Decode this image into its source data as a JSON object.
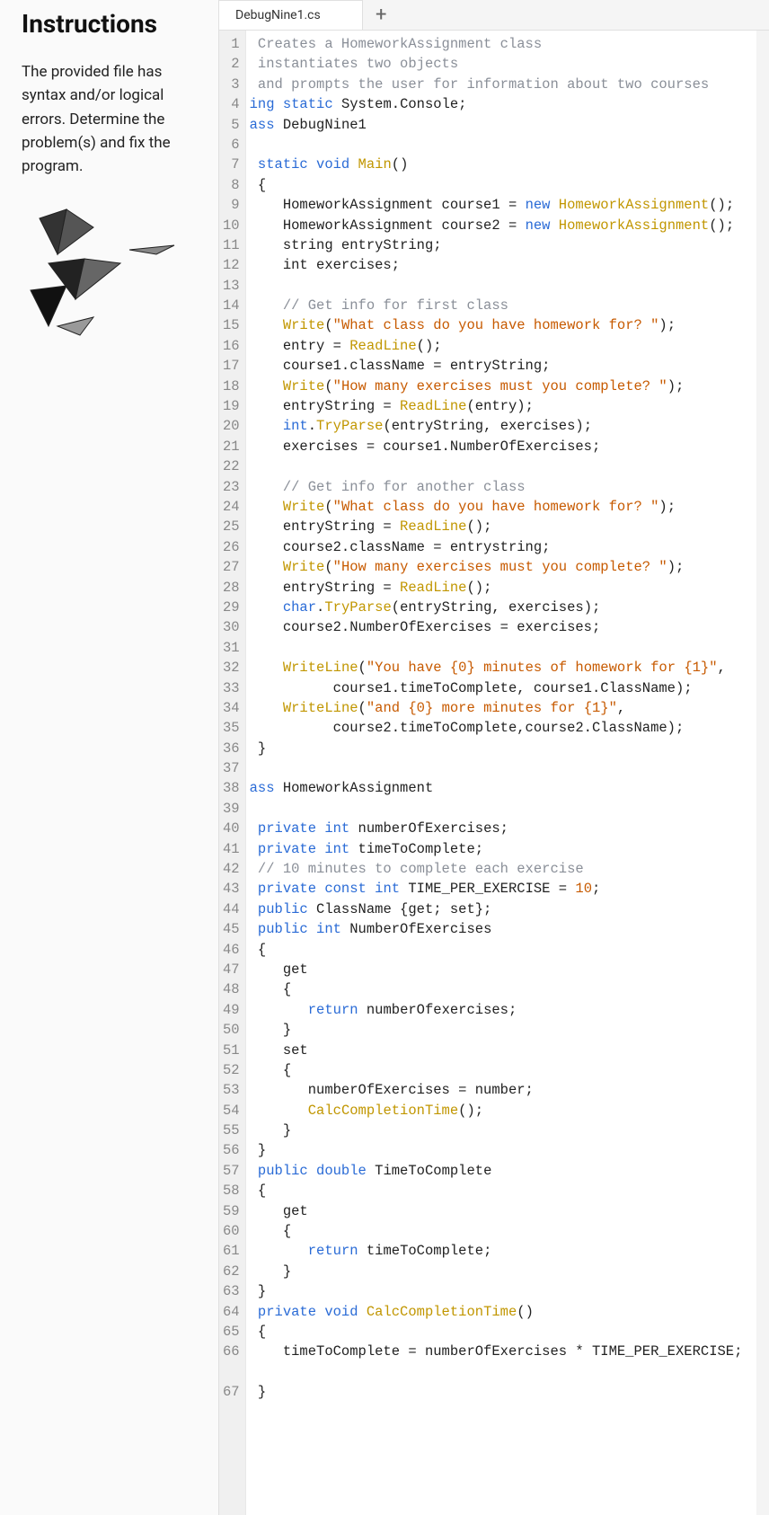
{
  "sidebar": {
    "title": "Instructions",
    "body": "The provided file has syntax and/or logical errors. Determine the problem(s) and fix the program."
  },
  "tabs": {
    "active": "DebugNine1.cs",
    "add_label": "+"
  },
  "code": [
    {
      "n": 1,
      "tokens": [
        {
          "t": " Creates a HomeworkAssignment class",
          "c": "comment"
        }
      ]
    },
    {
      "n": 2,
      "tokens": [
        {
          "t": " instantiates two objects",
          "c": "comment"
        }
      ]
    },
    {
      "n": 3,
      "tokens": [
        {
          "t": " and prompts the user for information about two courses",
          "c": "comment"
        }
      ]
    },
    {
      "n": 4,
      "tokens": [
        {
          "t": "ing ",
          "c": "keyword"
        },
        {
          "t": "static ",
          "c": "keyword"
        },
        {
          "t": "System.Console;",
          "c": ""
        }
      ]
    },
    {
      "n": 5,
      "tokens": [
        {
          "t": "ass ",
          "c": "keyword"
        },
        {
          "t": "DebugNine1",
          "c": ""
        }
      ]
    },
    {
      "n": 6,
      "tokens": []
    },
    {
      "n": 7,
      "tokens": [
        {
          "t": " static ",
          "c": "keyword"
        },
        {
          "t": "void ",
          "c": "keyword"
        },
        {
          "t": "Main",
          "c": "func"
        },
        {
          "t": "()",
          "c": ""
        }
      ]
    },
    {
      "n": 8,
      "tokens": [
        {
          "t": " {",
          "c": ""
        }
      ]
    },
    {
      "n": 9,
      "tokens": [
        {
          "t": "    HomeworkAssignment course1 = ",
          "c": ""
        },
        {
          "t": "new ",
          "c": "keyword"
        },
        {
          "t": "HomeworkAssignment",
          "c": "class"
        },
        {
          "t": "();",
          "c": ""
        }
      ]
    },
    {
      "n": 10,
      "tokens": [
        {
          "t": "    HomeworkAssignment course2 = ",
          "c": ""
        },
        {
          "t": "new ",
          "c": "keyword"
        },
        {
          "t": "HomeworkAssignment",
          "c": "class"
        },
        {
          "t": "();",
          "c": ""
        }
      ]
    },
    {
      "n": 11,
      "tokens": [
        {
          "t": "    string entryString;",
          "c": ""
        }
      ]
    },
    {
      "n": 12,
      "tokens": [
        {
          "t": "    int exercises;",
          "c": ""
        }
      ]
    },
    {
      "n": 13,
      "tokens": []
    },
    {
      "n": 14,
      "tokens": [
        {
          "t": "    // Get info for first class",
          "c": "comment"
        }
      ]
    },
    {
      "n": 15,
      "tokens": [
        {
          "t": "    ",
          "c": ""
        },
        {
          "t": "Write",
          "c": "method"
        },
        {
          "t": "(",
          "c": ""
        },
        {
          "t": "\"What class do you have homework for? \"",
          "c": "string"
        },
        {
          "t": ");",
          "c": ""
        }
      ]
    },
    {
      "n": 16,
      "tokens": [
        {
          "t": "    entry = ",
          "c": ""
        },
        {
          "t": "ReadLine",
          "c": "method"
        },
        {
          "t": "();",
          "c": ""
        }
      ]
    },
    {
      "n": 17,
      "tokens": [
        {
          "t": "    course1.className = entryString;",
          "c": ""
        }
      ]
    },
    {
      "n": 18,
      "tokens": [
        {
          "t": "    ",
          "c": ""
        },
        {
          "t": "Write",
          "c": "method"
        },
        {
          "t": "(",
          "c": ""
        },
        {
          "t": "\"How many exercises must you complete? \"",
          "c": "string"
        },
        {
          "t": ");",
          "c": ""
        }
      ]
    },
    {
      "n": 19,
      "tokens": [
        {
          "t": "    entryString = ",
          "c": ""
        },
        {
          "t": "ReadLine",
          "c": "method"
        },
        {
          "t": "(entry);",
          "c": ""
        }
      ]
    },
    {
      "n": 20,
      "tokens": [
        {
          "t": "    ",
          "c": ""
        },
        {
          "t": "int",
          "c": "keyword"
        },
        {
          "t": ".",
          "c": ""
        },
        {
          "t": "TryParse",
          "c": "method"
        },
        {
          "t": "(entryString, exercises);",
          "c": ""
        }
      ]
    },
    {
      "n": 21,
      "tokens": [
        {
          "t": "    exercises = course1.NumberOfExercises;",
          "c": ""
        }
      ]
    },
    {
      "n": 22,
      "tokens": []
    },
    {
      "n": 23,
      "tokens": [
        {
          "t": "    // Get info for another class",
          "c": "comment"
        }
      ]
    },
    {
      "n": 24,
      "tokens": [
        {
          "t": "    ",
          "c": ""
        },
        {
          "t": "Write",
          "c": "method"
        },
        {
          "t": "(",
          "c": ""
        },
        {
          "t": "\"What class do you have homework for? \"",
          "c": "string"
        },
        {
          "t": ");",
          "c": ""
        }
      ]
    },
    {
      "n": 25,
      "tokens": [
        {
          "t": "    entryString = ",
          "c": ""
        },
        {
          "t": "ReadLine",
          "c": "method"
        },
        {
          "t": "();",
          "c": ""
        }
      ]
    },
    {
      "n": 26,
      "tokens": [
        {
          "t": "    course2.className = entrystring;",
          "c": ""
        }
      ]
    },
    {
      "n": 27,
      "tokens": [
        {
          "t": "    ",
          "c": ""
        },
        {
          "t": "Write",
          "c": "method"
        },
        {
          "t": "(",
          "c": ""
        },
        {
          "t": "\"How many exercises must you complete? \"",
          "c": "string"
        },
        {
          "t": ");",
          "c": ""
        }
      ]
    },
    {
      "n": 28,
      "tokens": [
        {
          "t": "    entryString = ",
          "c": ""
        },
        {
          "t": "ReadLine",
          "c": "method"
        },
        {
          "t": "();",
          "c": ""
        }
      ]
    },
    {
      "n": 29,
      "tokens": [
        {
          "t": "    ",
          "c": ""
        },
        {
          "t": "char",
          "c": "keyword"
        },
        {
          "t": ".",
          "c": ""
        },
        {
          "t": "TryParse",
          "c": "method"
        },
        {
          "t": "(entryString, exercises);",
          "c": ""
        }
      ]
    },
    {
      "n": 30,
      "tokens": [
        {
          "t": "    course2.NumberOfExercises = exercises;",
          "c": ""
        }
      ]
    },
    {
      "n": 31,
      "tokens": []
    },
    {
      "n": 32,
      "tokens": [
        {
          "t": "    ",
          "c": ""
        },
        {
          "t": "WriteLine",
          "c": "method"
        },
        {
          "t": "(",
          "c": ""
        },
        {
          "t": "\"You have {0} minutes of homework for {1}\"",
          "c": "string"
        },
        {
          "t": ",",
          "c": ""
        }
      ]
    },
    {
      "n": 33,
      "tokens": [
        {
          "t": "          course1.timeToComplete, course1.ClassName);",
          "c": ""
        }
      ]
    },
    {
      "n": 34,
      "tokens": [
        {
          "t": "    ",
          "c": ""
        },
        {
          "t": "WriteLine",
          "c": "method"
        },
        {
          "t": "(",
          "c": ""
        },
        {
          "t": "\"and {0} more minutes for {1}\"",
          "c": "string"
        },
        {
          "t": ",",
          "c": ""
        }
      ]
    },
    {
      "n": 35,
      "tokens": [
        {
          "t": "          course2.timeToComplete,course2.ClassName);",
          "c": ""
        }
      ]
    },
    {
      "n": 36,
      "tokens": [
        {
          "t": " }",
          "c": ""
        }
      ]
    },
    {
      "n": 37,
      "tokens": []
    },
    {
      "n": 38,
      "tokens": [
        {
          "t": "ass ",
          "c": "keyword"
        },
        {
          "t": "HomeworkAssignment",
          "c": ""
        }
      ]
    },
    {
      "n": 39,
      "tokens": []
    },
    {
      "n": 40,
      "tokens": [
        {
          "t": " private ",
          "c": "keyword"
        },
        {
          "t": "int ",
          "c": "keyword"
        },
        {
          "t": "numberOfExercises;",
          "c": ""
        }
      ]
    },
    {
      "n": 41,
      "tokens": [
        {
          "t": " private ",
          "c": "keyword"
        },
        {
          "t": "int ",
          "c": "keyword"
        },
        {
          "t": "timeToComplete;",
          "c": ""
        }
      ]
    },
    {
      "n": 42,
      "tokens": [
        {
          "t": " // 10 minutes to complete each exercise",
          "c": "comment"
        }
      ]
    },
    {
      "n": 43,
      "tokens": [
        {
          "t": " private ",
          "c": "keyword"
        },
        {
          "t": "const ",
          "c": "keyword"
        },
        {
          "t": "int ",
          "c": "keyword"
        },
        {
          "t": "TIME_PER_EXERCISE = ",
          "c": ""
        },
        {
          "t": "10",
          "c": "number"
        },
        {
          "t": ";",
          "c": ""
        }
      ]
    },
    {
      "n": 44,
      "tokens": [
        {
          "t": " public ",
          "c": "keyword"
        },
        {
          "t": "ClassName {get; set};",
          "c": ""
        }
      ]
    },
    {
      "n": 45,
      "tokens": [
        {
          "t": " public ",
          "c": "keyword"
        },
        {
          "t": "int ",
          "c": "keyword"
        },
        {
          "t": "NumberOfExercises",
          "c": ""
        }
      ]
    },
    {
      "n": 46,
      "tokens": [
        {
          "t": " {",
          "c": ""
        }
      ]
    },
    {
      "n": 47,
      "tokens": [
        {
          "t": "    get",
          "c": ""
        }
      ]
    },
    {
      "n": 48,
      "tokens": [
        {
          "t": "    {",
          "c": ""
        }
      ]
    },
    {
      "n": 49,
      "tokens": [
        {
          "t": "       ",
          "c": ""
        },
        {
          "t": "return ",
          "c": "keyword"
        },
        {
          "t": "numberOfexercises;",
          "c": ""
        }
      ]
    },
    {
      "n": 50,
      "tokens": [
        {
          "t": "    }",
          "c": ""
        }
      ]
    },
    {
      "n": 51,
      "tokens": [
        {
          "t": "    set",
          "c": ""
        }
      ]
    },
    {
      "n": 52,
      "tokens": [
        {
          "t": "    {",
          "c": ""
        }
      ]
    },
    {
      "n": 53,
      "tokens": [
        {
          "t": "       numberOfExercises = number;",
          "c": ""
        }
      ]
    },
    {
      "n": 54,
      "tokens": [
        {
          "t": "       ",
          "c": ""
        },
        {
          "t": "CalcCompletionTime",
          "c": "method"
        },
        {
          "t": "();",
          "c": ""
        }
      ]
    },
    {
      "n": 55,
      "tokens": [
        {
          "t": "    }",
          "c": ""
        }
      ]
    },
    {
      "n": 56,
      "tokens": [
        {
          "t": " }",
          "c": ""
        }
      ]
    },
    {
      "n": 57,
      "tokens": [
        {
          "t": " public ",
          "c": "keyword"
        },
        {
          "t": "double ",
          "c": "keyword"
        },
        {
          "t": "TimeToComplete",
          "c": ""
        }
      ]
    },
    {
      "n": 58,
      "tokens": [
        {
          "t": " {",
          "c": ""
        }
      ]
    },
    {
      "n": 59,
      "tokens": [
        {
          "t": "    get",
          "c": ""
        }
      ]
    },
    {
      "n": 60,
      "tokens": [
        {
          "t": "    {",
          "c": ""
        }
      ]
    },
    {
      "n": 61,
      "tokens": [
        {
          "t": "       ",
          "c": ""
        },
        {
          "t": "return ",
          "c": "keyword"
        },
        {
          "t": "timeToComplete;",
          "c": ""
        }
      ]
    },
    {
      "n": 62,
      "tokens": [
        {
          "t": "    }",
          "c": ""
        }
      ]
    },
    {
      "n": 63,
      "tokens": [
        {
          "t": " }",
          "c": ""
        }
      ]
    },
    {
      "n": 64,
      "tokens": [
        {
          "t": " private ",
          "c": "keyword"
        },
        {
          "t": "void ",
          "c": "keyword"
        },
        {
          "t": "CalcCompletionTime",
          "c": "func"
        },
        {
          "t": "()",
          "c": ""
        }
      ]
    },
    {
      "n": 65,
      "tokens": [
        {
          "t": " {",
          "c": ""
        }
      ]
    },
    {
      "n": 66,
      "tokens": [
        {
          "t": "    timeToComplete = numberOfExercises * TIME_PER_EXERCISE;",
          "c": ""
        }
      ]
    },
    {
      "n": "",
      "tokens": []
    },
    {
      "n": 67,
      "tokens": [
        {
          "t": " }",
          "c": ""
        }
      ]
    }
  ]
}
